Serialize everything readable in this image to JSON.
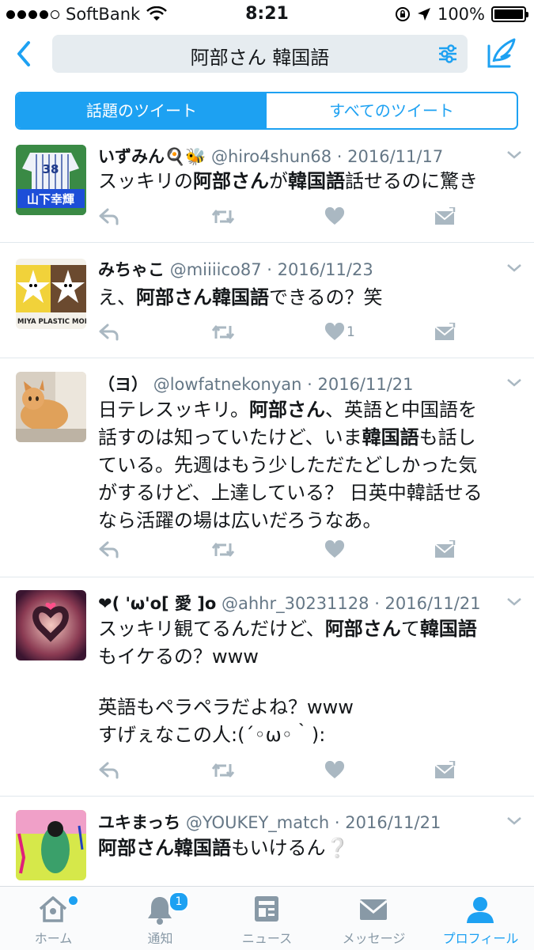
{
  "status": {
    "carrier": "SoftBank",
    "time": "8:21",
    "battery": "100%",
    "battery_level": 1.0
  },
  "search": {
    "query": "阿部さん 韓国語"
  },
  "tabs": [
    {
      "label": "話題のツイート",
      "active": true
    },
    {
      "label": "すべてのツイート",
      "active": false
    }
  ],
  "tweets": [
    {
      "name": "いずみん🍳🐝",
      "handle": "@hiro4shun68",
      "date": "· 2016/11/17",
      "avatar_text": "山下幸輝",
      "avatar_number": "38",
      "body_parts": [
        "スッキリの",
        "阿部さん",
        "が",
        "韓国語",
        "話せるのに驚き"
      ],
      "like_count": ""
    },
    {
      "name": "みちゃこ",
      "handle": "@miiiico87",
      "date": "· 2016/11/23",
      "avatar_text": "MIYA PLASTIC MODEL C",
      "body_parts": [
        "え、",
        "阿部さん",
        "韓国語",
        "できるの？笑"
      ],
      "like_count": "1"
    },
    {
      "name": "（ヨ）",
      "handle": "@lowfatnekonyan",
      "date": "· 2016/11/21",
      "body_lines": [
        [
          "日テレスッキリ。",
          "阿部さん",
          "、英語と中国語を"
        ],
        [
          "話すのは知っていたけど、いま",
          "韓国語",
          "も話し"
        ],
        [
          "ている。先週はもう少しただたどしかった気"
        ],
        [
          "がするけど、上達している？ 日英中韓話せる"
        ],
        [
          "なら活躍の場は広いだろうなあ。"
        ]
      ],
      "like_count": ""
    },
    {
      "name": "❤( 'ω'o[ 愛 ]o",
      "handle": "@ahhr_30231128",
      "date": "· 2016/11/21",
      "body_lines": [
        [
          "スッキリ観てるんだけど、",
          "阿部さん",
          "て",
          "韓国語"
        ],
        [
          "もイケるの？www"
        ],
        [
          ""
        ],
        [
          "英語もペラペラだよね？www"
        ],
        [
          "すげぇなこの人:(´◦ω◦｀):"
        ]
      ],
      "like_count": ""
    },
    {
      "name": "ユキまっち",
      "handle": "@YOUKEY_match",
      "date": "· 2016/11/21",
      "body_parts": [
        "阿部さん",
        "韓国語",
        "もいけるん❔"
      ],
      "like_count": ""
    }
  ],
  "tabbar": [
    {
      "label": "ホーム",
      "icon": "home-icon"
    },
    {
      "label": "通知",
      "icon": "bell-icon",
      "badge": "1"
    },
    {
      "label": "ニュース",
      "icon": "news-icon"
    },
    {
      "label": "メッセージ",
      "icon": "envelope-icon"
    },
    {
      "label": "プロフィール",
      "icon": "person-icon",
      "active": true
    }
  ],
  "colors": {
    "accent": "#1da1f2",
    "muted": "#657786",
    "icon": "#aab8c2"
  }
}
